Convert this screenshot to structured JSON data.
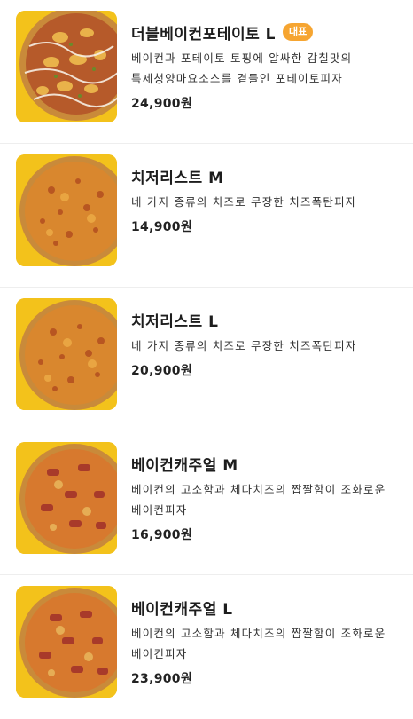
{
  "menu_items": [
    {
      "name": "더블베이컨포테이토 L",
      "badge": "대표",
      "description": "베이컨과 포테이토 토핑에 알싸한 감칠맛의 특제청양마요소스를 곁들인 포테이토피자",
      "price": "24,900원",
      "image": "potato-bacon-pizza-image"
    },
    {
      "name": "치저리스트 M",
      "description": "네 가지 종류의 치즈로 무장한 치즈폭탄피자",
      "price": "14,900원",
      "image": "cheese-pizza-image"
    },
    {
      "name": "치저리스트 L",
      "description": "네 가지 종류의 치즈로 무장한 치즈폭탄피자",
      "price": "20,900원",
      "image": "cheese-pizza-image"
    },
    {
      "name": "베이컨캐주얼 M",
      "description": "베이컨의 고소함과 체다치즈의 짭짤함이 조화로운 베이컨피자",
      "price": "16,900원",
      "image": "bacon-pizza-image"
    },
    {
      "name": "베이컨캐주얼 L",
      "description": "베이컨의 고소함과 체다치즈의 짭짤함이 조화로운 베이컨피자",
      "price": "23,900원",
      "image": "bacon-pizza-image"
    }
  ],
  "colors": {
    "thumbnail_background": "#f3c21b",
    "badge": "#f6a531",
    "divider": "#eeeeee"
  }
}
